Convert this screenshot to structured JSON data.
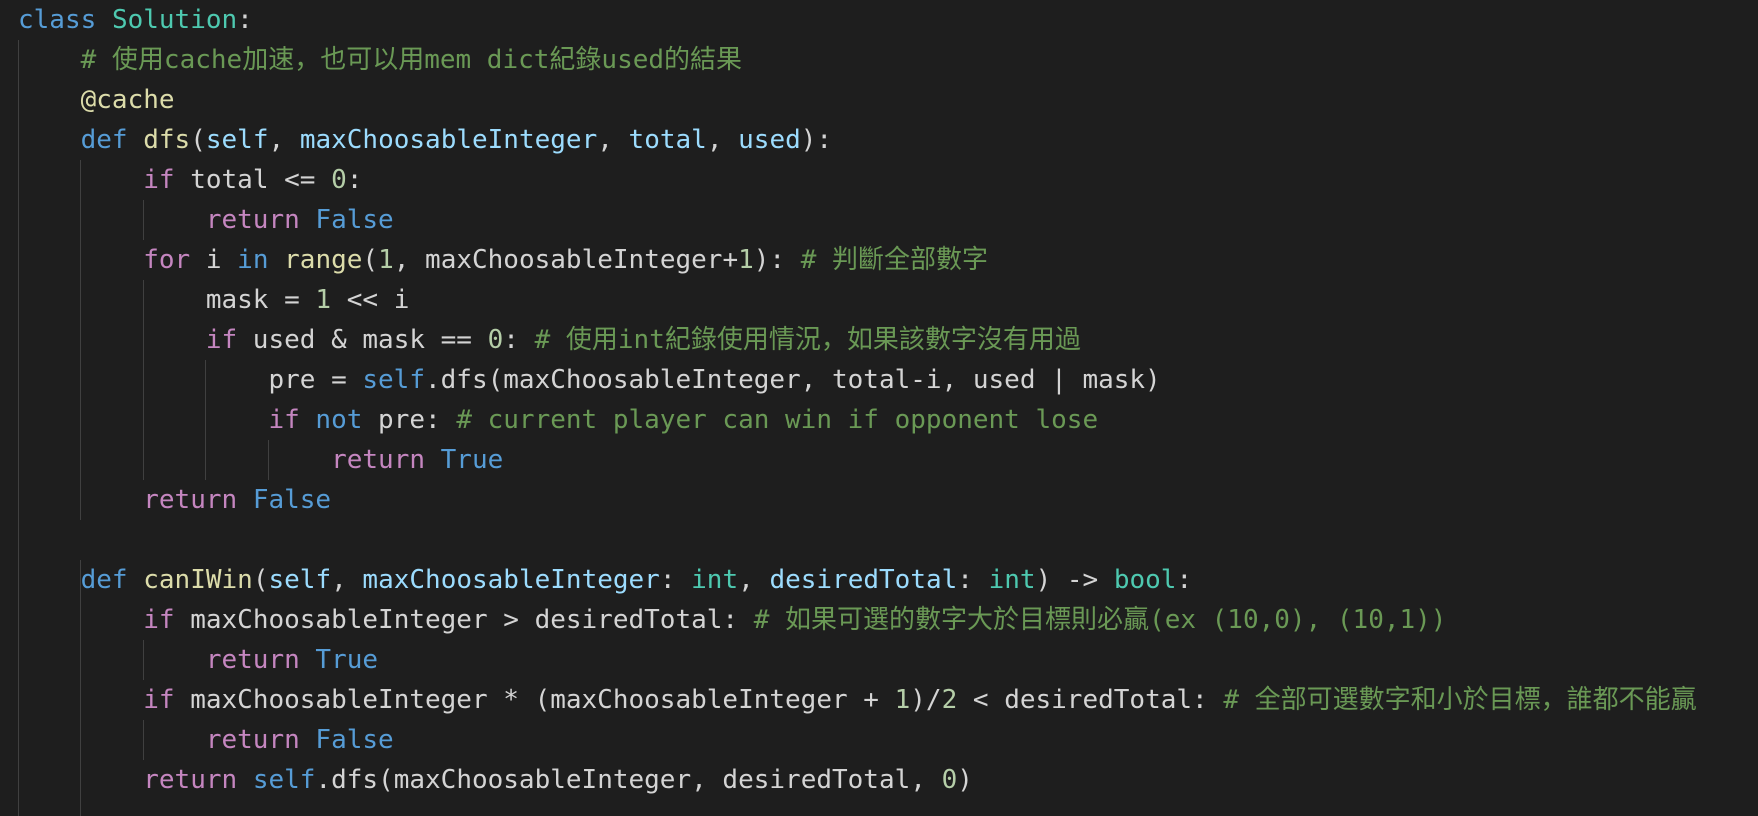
{
  "editor": {
    "theme_colors": {
      "background": "#1e1e1e",
      "keyword": "#569cd6",
      "control": "#c586c0",
      "function": "#dcdcaa",
      "class": "#4ec9b0",
      "parameter": "#9cdcfe",
      "number": "#b5cea8",
      "comment": "#6a9955",
      "text": "#d4d4d4"
    },
    "code": {
      "l1": {
        "kw_class": "class",
        "name": "Solution",
        "colon": ":"
      },
      "l2": {
        "comment": "# 使用cache加速，也可以用mem dict紀錄used的結果"
      },
      "l3": {
        "decorator": "@cache"
      },
      "l4": {
        "kw_def": "def",
        "fname": "dfs",
        "open": "(",
        "p_self": "self",
        "sep1": ", ",
        "p_max": "maxChoosableInteger",
        "sep2": ", ",
        "p_total": "total",
        "sep3": ", ",
        "p_used": "used",
        "close": "):"
      },
      "l5": {
        "kw_if": "if",
        "rest1": " total <= ",
        "num": "0",
        "rest2": ":"
      },
      "l6": {
        "kw_return": "return",
        "val": "False"
      },
      "l7": {
        "kw_for": "for",
        "rest1": " i ",
        "kw_in": "in",
        "sp": " ",
        "fn_range": "range",
        "rest2": "(",
        "num1": "1",
        "rest3": ", maxChoosableInteger+",
        "num2": "1",
        "rest4": "): ",
        "comment": "# 判斷全部數字"
      },
      "l8": {
        "rest1": "mask = ",
        "num": "1",
        "rest2": " << i"
      },
      "l9": {
        "kw_if": "if",
        "rest1": " used & mask == ",
        "num": "0",
        "rest2": ": ",
        "comment": "# 使用int紀錄使用情況，如果該數字沒有用過"
      },
      "l10": {
        "rest1": "pre = ",
        "kw_self": "self",
        "rest2": ".dfs(maxChoosableInteger, total-i, used | mask)"
      },
      "l11": {
        "kw_if": "if",
        "sp": " ",
        "kw_not": "not",
        "rest1": " pre: ",
        "comment": "# current player can win if opponent lose"
      },
      "l12": {
        "kw_return": "return",
        "val": "True"
      },
      "l13": {
        "kw_return": "return",
        "val": "False"
      },
      "l15": {
        "kw_def": "def",
        "fname": "canIWin",
        "open": "(",
        "p_self": "self",
        "sep1": ", ",
        "p_max": "maxChoosableInteger",
        "colon1": ": ",
        "t_int1": "int",
        "sep2": ", ",
        "p_desired": "desiredTotal",
        "colon2": ": ",
        "t_int2": "int",
        "arrow": ") -> ",
        "t_bool": "bool",
        "end": ":"
      },
      "l16": {
        "kw_if": "if",
        "rest1": " maxChoosableInteger > desiredTotal: ",
        "comment": "# 如果可選的數字大於目標則必贏(ex (10,0), (10,1))"
      },
      "l17": {
        "kw_return": "return",
        "val": "True"
      },
      "l18": {
        "kw_if": "if",
        "rest1": " maxChoosableInteger * (maxChoosableInteger + ",
        "num": "1",
        "rest2": ")/",
        "num2": "2",
        "rest3": " < desiredTotal: ",
        "comment": "# 全部可選數字和小於目標，誰都不能贏"
      },
      "l19": {
        "kw_return": "return",
        "val": "False"
      },
      "l20": {
        "kw_return": "return",
        "sp": " ",
        "kw_self": "self",
        "rest1": ".dfs(maxChoosableInteger, desiredTotal, ",
        "num": "0",
        "rest2": ")"
      }
    }
  }
}
